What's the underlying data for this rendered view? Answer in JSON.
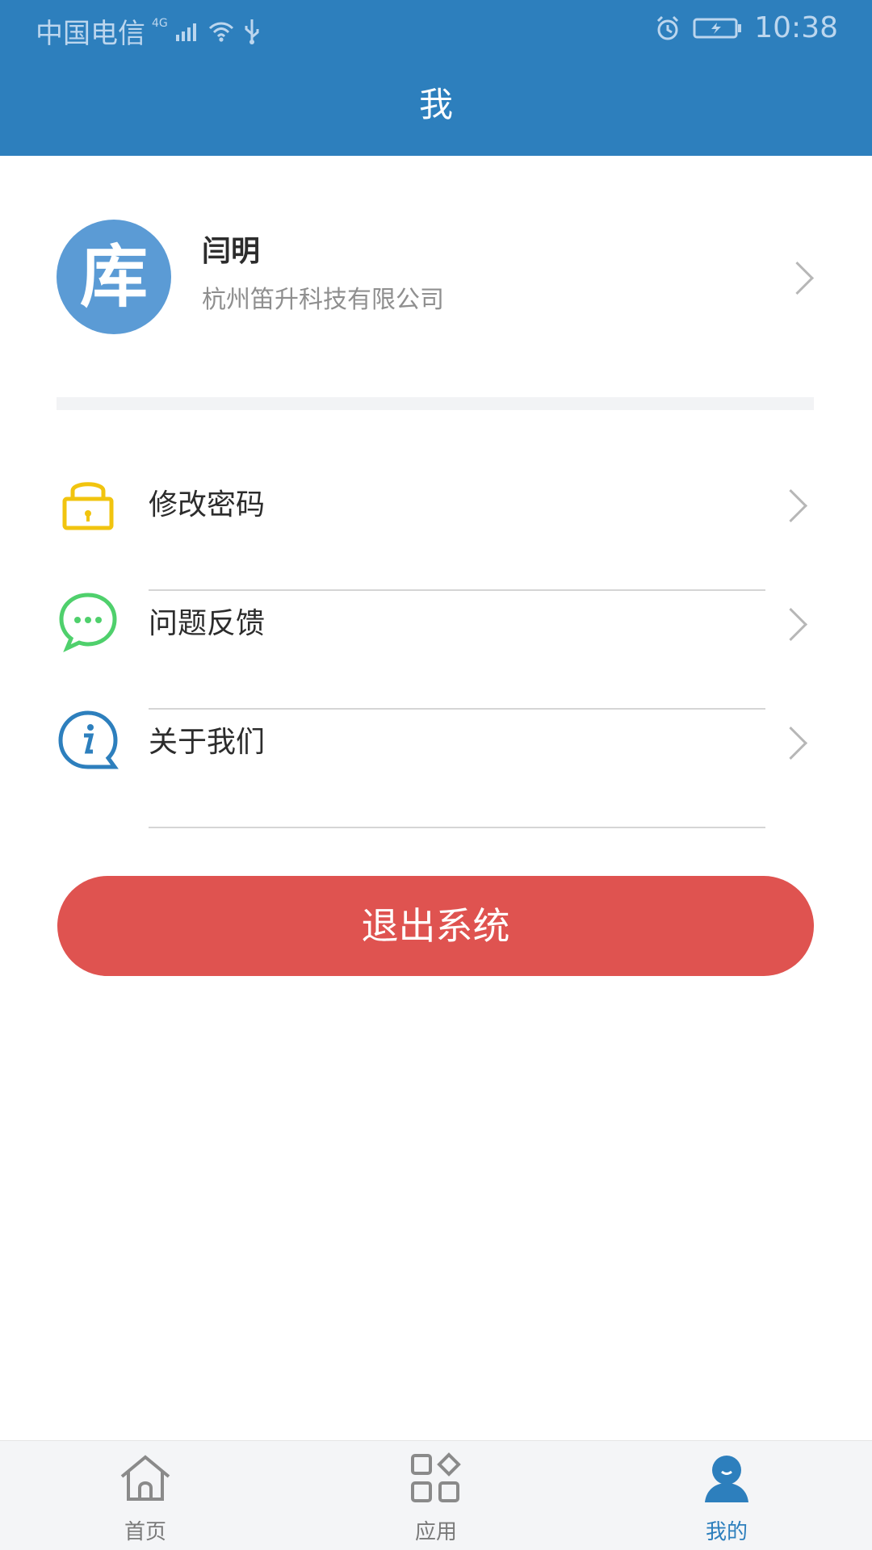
{
  "status_bar": {
    "carrier": "中国电信",
    "network": "4G",
    "time": "10:38"
  },
  "header": {
    "title": "我"
  },
  "profile": {
    "avatar_text": "库",
    "name": "闫明",
    "company": "杭州笛升科技有限公司"
  },
  "menu": {
    "items": [
      {
        "label": "修改密码",
        "icon": "lock-icon"
      },
      {
        "label": "问题反馈",
        "icon": "chat-icon"
      },
      {
        "label": "关于我们",
        "icon": "info-icon"
      }
    ]
  },
  "logout": {
    "label": "退出系统"
  },
  "bottom_nav": {
    "tabs": [
      {
        "label": "首页",
        "icon": "home-icon"
      },
      {
        "label": "应用",
        "icon": "apps-icon"
      },
      {
        "label": "我的",
        "icon": "profile-icon"
      }
    ],
    "active_tab": "我的"
  },
  "colors": {
    "brand_blue": "#2d7fbd",
    "logout_red": "#df5350",
    "lock_yellow": "#f1c40f",
    "chat_green": "#4fd06c",
    "info_blue": "#2d7fbd"
  }
}
